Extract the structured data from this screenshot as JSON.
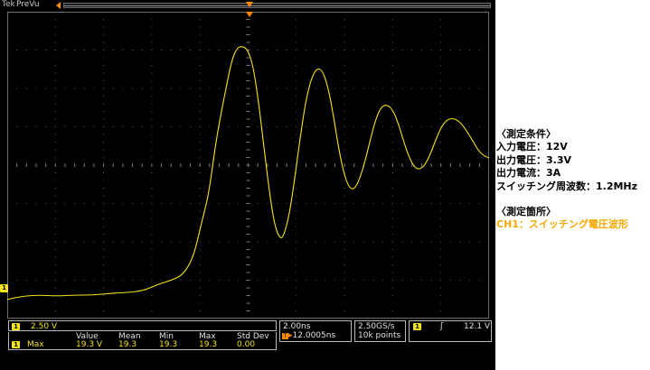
{
  "topbar": {
    "brand": "Tek",
    "mode": "PreVu"
  },
  "channel": {
    "marker": "1",
    "scale": "2.50 V",
    "color": "#f5e31a"
  },
  "timebase": {
    "scale": "2.00ns",
    "position": "12.0005ns"
  },
  "acquisition": {
    "rate": "2.50GS/s",
    "record": "10k points"
  },
  "trigger": {
    "source": "1",
    "slope_glyph": "ʃ",
    "level": "12.1 V",
    "marker_color": "#ff8c00"
  },
  "measurement": {
    "headers": [
      "Value",
      "Mean",
      "Min",
      "Max",
      "Std Dev"
    ],
    "row": {
      "channel": "1",
      "name": "Max",
      "values": [
        "19.3 V",
        "19.3",
        "19.3",
        "19.3",
        "0.00"
      ]
    }
  },
  "notes": {
    "section1_title": "〈測定条件〉",
    "lines": [
      "入力電圧：12V",
      "出力電圧：3.3V",
      "出力電流：3A",
      "スイッチング周波数：1.2MHz"
    ],
    "section2_title": "〈測定箇所〉",
    "ch1_label": "CH1：スイッチング電圧波形"
  }
}
